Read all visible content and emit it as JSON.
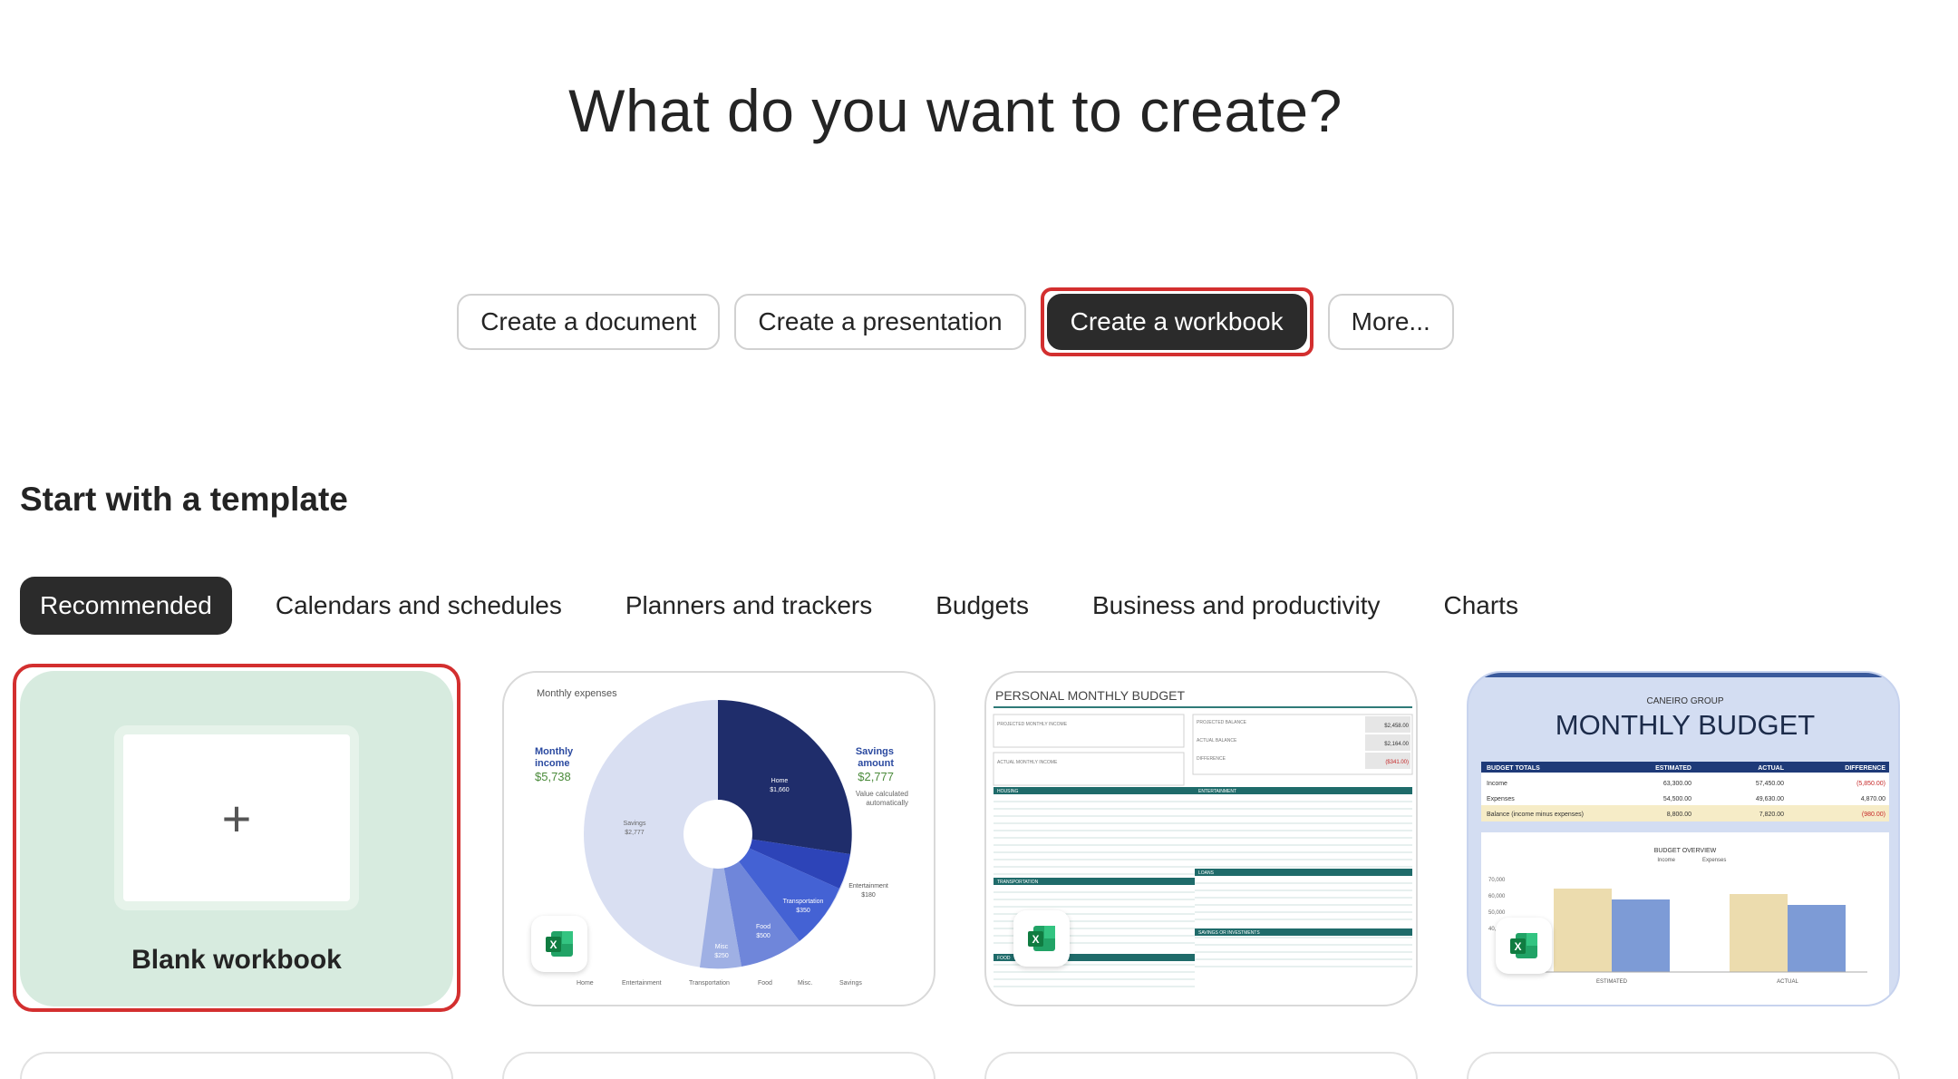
{
  "header": {
    "title": "What do you want to create?"
  },
  "create_options": [
    {
      "label": "Create a document"
    },
    {
      "label": "Create a presentation"
    },
    {
      "label": "Create a workbook"
    },
    {
      "label": "More..."
    }
  ],
  "templates": {
    "section_title": "Start with a template",
    "tabs": [
      {
        "label": "Recommended"
      },
      {
        "label": "Calendars and schedules"
      },
      {
        "label": "Planners and trackers"
      },
      {
        "label": "Budgets"
      },
      {
        "label": "Business and productivity"
      },
      {
        "label": "Charts"
      }
    ],
    "blank": {
      "label": "Blank workbook",
      "plus": "+"
    },
    "monthly_expenses": {
      "title": "Monthly expenses",
      "left_label_1": "Monthly",
      "left_label_2": "income",
      "left_value": "$5,738",
      "right_label_1": "Savings",
      "right_label_2": "amount",
      "right_value": "$2,777",
      "right_note_1": "Value calculated",
      "right_note_2": "automatically",
      "home": "Home",
      "home_v": "$1,660",
      "savings": "Savings",
      "savings_v": "$2,777",
      "entertainment": "Entertainment",
      "entertainment_v": "$180",
      "transportation": "Transportation",
      "transportation_v": "$350",
      "food": "Food",
      "food_v": "$500",
      "misc": "Misc",
      "misc_v": "$250",
      "legend": [
        "Home",
        "Entertainment",
        "Transportation",
        "Food",
        "Misc.",
        "Savings"
      ]
    },
    "personal_budget": {
      "title": "PERSONAL MONTHLY BUDGET",
      "labels": [
        "PROJECTED MONTHLY INCOME",
        "ACTUAL MONTHLY INCOME",
        "PROJECTED BALANCE",
        "ACTUAL BALANCE",
        "DIFFERENCE",
        "HOUSING",
        "ENTERTAINMENT",
        "TRANSPORTATION",
        "LOANS",
        "SAVINGS OR INVESTMENTS",
        "FOOD"
      ],
      "values": [
        "$2,458.00",
        "$2,164.00",
        "($341.00)"
      ]
    },
    "monthly_budget": {
      "company": "CANEIRO GROUP",
      "title": "MONTHLY BUDGET",
      "headers": [
        "BUDGET TOTALS",
        "ESTIMATED",
        "ACTUAL",
        "DIFFERENCE"
      ],
      "rows": [
        [
          "Income",
          "63,300.00",
          "57,450.00",
          "(5,850.00)"
        ],
        [
          "Expenses",
          "54,500.00",
          "49,630.00",
          "4,870.00"
        ],
        [
          "Balance (income minus expenses)",
          "8,800.00",
          "7,820.00",
          "(980.00)"
        ]
      ],
      "overview": "BUDGET OVERVIEW",
      "legend": [
        "Income",
        "Expenses"
      ],
      "yticks": [
        "70,000",
        "60,000",
        "50,000",
        "40,000"
      ],
      "xlabels": [
        "ESTIMATED",
        "ACTUAL"
      ]
    }
  },
  "colors": {
    "accent_dark": "#2b2b2b",
    "highlight": "#d32f2f",
    "excel_green": "#107c41",
    "blank_bg": "#d7ebdf"
  }
}
